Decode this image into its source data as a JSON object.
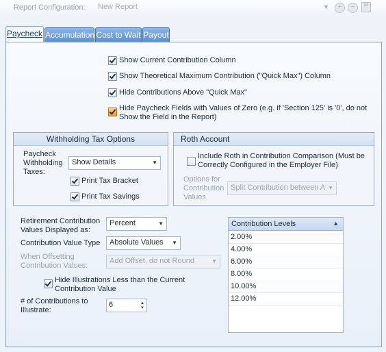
{
  "report_config": {
    "label": "Report Configuration:",
    "value": "New Report",
    "icons": [
      "add-icon",
      "remove-icon",
      "save-icon"
    ]
  },
  "tabs": [
    {
      "label": "Paycheck",
      "active": true
    },
    {
      "label": "Accumulation",
      "active": false
    },
    {
      "label": "Cost to Wait",
      "active": false
    },
    {
      "label": "Payout",
      "active": false
    }
  ],
  "options": {
    "show_current": "Show Current Contribution Column",
    "show_theoretical": "Show Theoretical Maximum Contribution (\"Quick Max\") Column",
    "hide_above_quick_max": "Hide Contributions Above \"Quick Max\"",
    "hide_zero_line1": "Hide Paycheck Fields with Values of Zero (e.g. if 'Section 125' is '0', do not",
    "hide_zero_line2": "Show the Field in the Report)"
  },
  "withholding": {
    "title": "Withholding Tax Options",
    "label_line1": "Paycheck",
    "label_line2": "Withholding",
    "label_line3": "Taxes:",
    "select_value": "Show Details",
    "print_bracket": "Print Tax Bracket",
    "print_savings": "Print Tax Savings"
  },
  "roth": {
    "title": "Roth Account",
    "include_line1": "Include Roth in Contribution Comparison (Must be",
    "include_line2": "Correctly Configured in the Employer File)",
    "options_line1": "Options for",
    "options_line2": "Contribution",
    "options_line3": "Values",
    "options_value": "Split Contribution between Ac"
  },
  "contrib": {
    "displayed_line1": "Retirement Contribution",
    "displayed_line2": "Values Displayed as:",
    "displayed_value": "Percent",
    "type_label": "Contribution Value Type",
    "type_value": "Absolute Values",
    "offset_line1": "When Offsetting",
    "offset_line2": "Contribution Values:",
    "offset_value": "Add Offset, do not Round",
    "hide_ill_line1": "Hide Illustrations Less than the Current",
    "hide_ill_line2": "Contribution Value",
    "num_line1": "# of Contributions to",
    "num_line2": "Illustrate:",
    "num_value": "6"
  },
  "levels": {
    "header": "Contribution Levels",
    "items": [
      "2.00%",
      "4.00%",
      "6.00%",
      "8.00%",
      "10.00%",
      "12.00%"
    ]
  }
}
